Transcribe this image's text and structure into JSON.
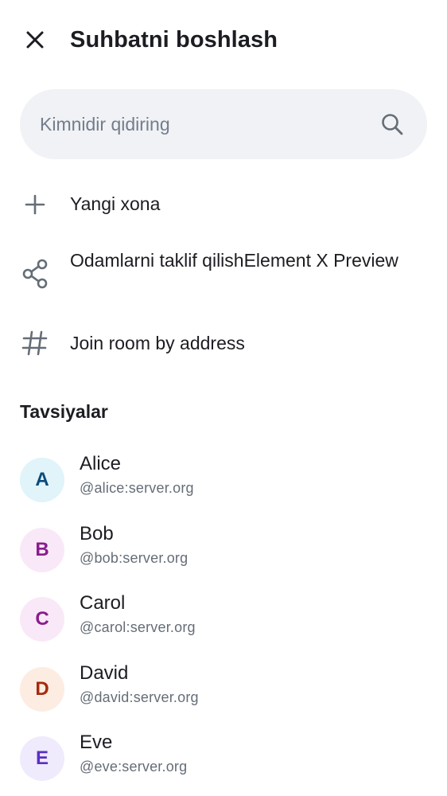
{
  "header": {
    "title": "Suhbatni boshlash",
    "close_icon": "close-icon"
  },
  "search": {
    "placeholder": "Kimnidir qidiring",
    "value": "",
    "icon": "search-icon"
  },
  "actions": [
    {
      "label": "Yangi xona",
      "icon": "plus-icon"
    },
    {
      "label": "Odamlarni taklif qilishElement X Preview",
      "icon": "share-icon"
    },
    {
      "label": "Join room by address",
      "icon": "hash-icon"
    }
  ],
  "suggestions": {
    "title": "Tavsiyalar",
    "users": [
      {
        "initial": "A",
        "name": "Alice",
        "id": "@alice:server.org",
        "avatar_bg": "#e0f4fa",
        "avatar_fg": "#0b4a7a"
      },
      {
        "initial": "B",
        "name": "Bob",
        "id": "@bob:server.org",
        "avatar_bg": "#f9e9f8",
        "avatar_fg": "#8a1c8e"
      },
      {
        "initial": "C",
        "name": "Carol",
        "id": "@carol:server.org",
        "avatar_bg": "#f9e9f8",
        "avatar_fg": "#8a1c8e"
      },
      {
        "initial": "D",
        "name": "David",
        "id": "@david:server.org",
        "avatar_bg": "#fdece2",
        "avatar_fg": "#a32b0d"
      },
      {
        "initial": "E",
        "name": "Eve",
        "id": "@eve:server.org",
        "avatar_bg": "#efeafc",
        "avatar_fg": "#5a2fc4"
      }
    ]
  },
  "colors": {
    "text_primary": "#1b1d22",
    "text_secondary": "#656d77",
    "icon": "#656d77",
    "search_bg": "#f0f2f5"
  }
}
